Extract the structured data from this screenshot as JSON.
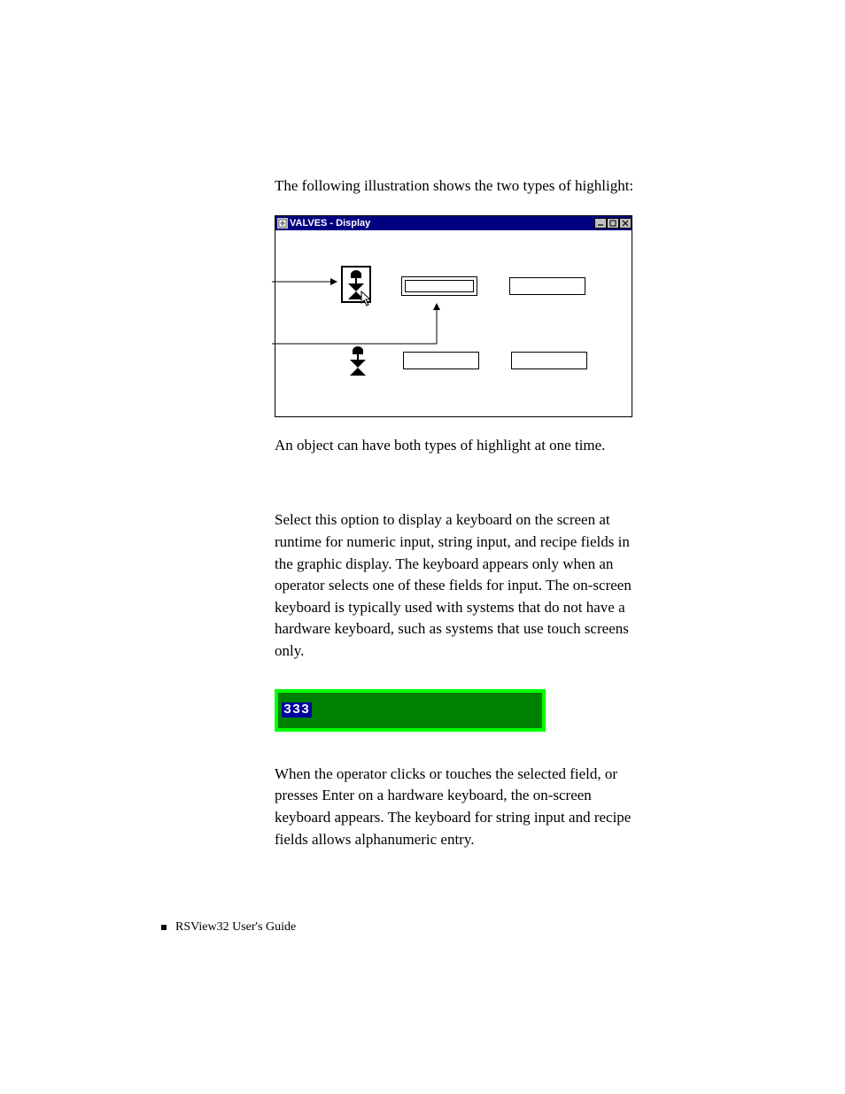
{
  "paragraphs": {
    "intro": "The following illustration shows the two types of highlight:",
    "both_types": "An object can have both types of highlight at one time.",
    "option_desc": "Select this option to display a keyboard on the screen at runtime for numeric input, string input, and recipe fields in the graphic display. The keyboard appears only when an operator selects one of these fields for input. The on-screen keyboard is typically used with systems that do not have a hardware keyboard, such as systems that use touch screens only.",
    "operator_action": "When the operator clicks or touches the selected field, or presses Enter on a hardware keyboard, the on-screen keyboard appears. The keyboard for string input and recipe fields allows alphanumeric entry."
  },
  "window": {
    "title": "VALVES - Display",
    "buttons": {
      "minimize": "_",
      "maximize": "□",
      "close": "×"
    }
  },
  "field": {
    "value": "333"
  },
  "footer": {
    "text": "RSView32  User's Guide"
  }
}
